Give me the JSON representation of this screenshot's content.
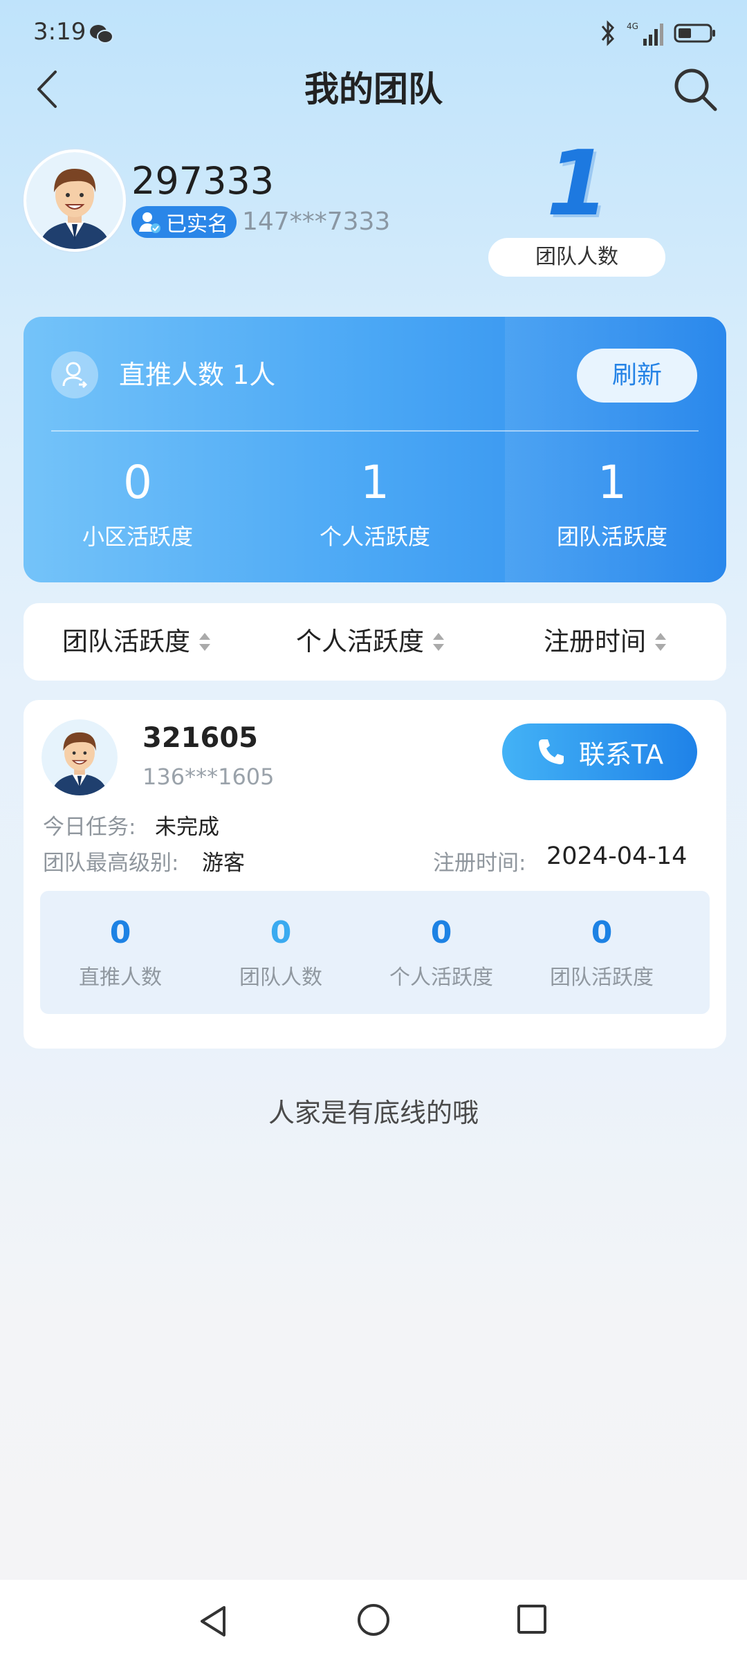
{
  "status_bar": {
    "time": "3:19",
    "network": "4G"
  },
  "header": {
    "title": "我的团队"
  },
  "profile": {
    "user_id": "297333",
    "verified_label": "已实名",
    "phone": "147***7333",
    "team_count": "1",
    "team_count_label": "团队人数"
  },
  "stat_card": {
    "direct_label": "直推人数 1人",
    "refresh_label": "刷新",
    "stats": [
      {
        "value": "0",
        "label": "小区活跃度"
      },
      {
        "value": "1",
        "label": "个人活跃度"
      },
      {
        "value": "1",
        "label": "团队活跃度"
      }
    ]
  },
  "sort_bar": {
    "items": [
      {
        "label": "团队活跃度"
      },
      {
        "label": "个人活跃度"
      },
      {
        "label": "注册时间"
      }
    ]
  },
  "member": {
    "id": "321605",
    "phone": "136***1605",
    "contact_label": "联系TA",
    "task_label": "今日任务:",
    "task_value": "未完成",
    "level_label": "团队最高级别:",
    "level_value": "游客",
    "reg_label": "注册时间:",
    "reg_value": "2024-04-14",
    "stats": [
      {
        "value": "0",
        "label": "直推人数"
      },
      {
        "value": "0",
        "label": "团队人数"
      },
      {
        "value": "0",
        "label": "个人活跃度"
      },
      {
        "value": "0",
        "label": "团队活跃度"
      }
    ]
  },
  "footer_note": "人家是有底线的哦",
  "colors": {
    "accent": "#1d79e0",
    "card_gradient_start": "#74c3f9",
    "card_gradient_end": "#2a88ec"
  }
}
